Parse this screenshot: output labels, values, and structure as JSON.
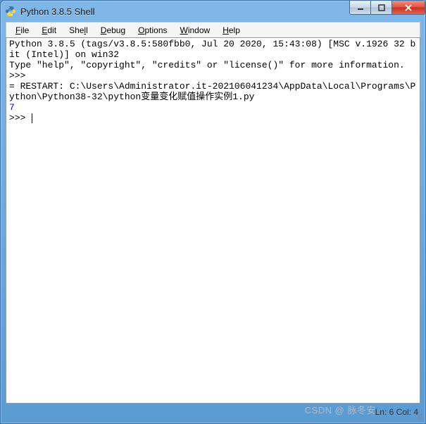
{
  "window": {
    "title": "Python 3.8.5 Shell"
  },
  "menu": {
    "file": "File",
    "edit": "Edit",
    "shell": "Shell",
    "debug": "Debug",
    "options": "Options",
    "window": "Window",
    "help": "Help"
  },
  "shell": {
    "banner1": "Python 3.8.5 (tags/v3.8.5:580fbb0, Jul 20 2020, 15:43:08) [MSC v.1926 32 bit (Intel)] on win32",
    "banner2": "Type \"help\", \"copyright\", \"credits\" or \"license()\" for more information.",
    "prompt1": ">>> ",
    "restart": "= RESTART: C:\\Users\\Administrator.it-202106041234\\AppData\\Local\\Programs\\Python\\Python38-32\\python变量变化赋值操作实例1.py",
    "output1": "7",
    "prompt2": ">>> "
  },
  "status": {
    "position": "Ln: 6  Col: 4"
  },
  "watermark": "CSDN @ 脉冬安"
}
